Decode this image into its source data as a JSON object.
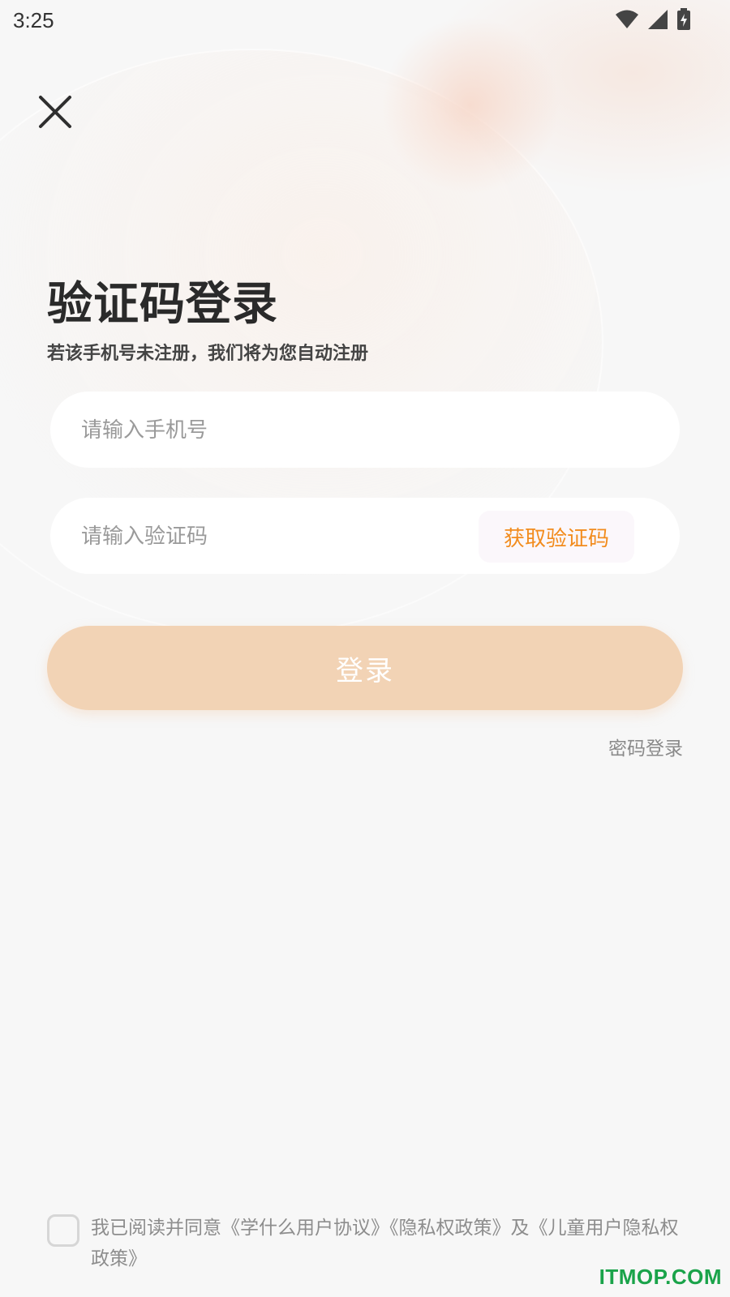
{
  "status_bar": {
    "time": "3:25",
    "icons": [
      "wifi-icon",
      "signal-icon",
      "battery-charging-icon"
    ]
  },
  "header": {
    "close_icon": "close-icon"
  },
  "page": {
    "title": "验证码登录",
    "subtitle": "若该手机号未注册，我们将为您自动注册"
  },
  "form": {
    "phone_placeholder": "请输入手机号",
    "phone_value": "",
    "code_placeholder": "请输入验证码",
    "code_value": "",
    "get_code_label": "获取验证码",
    "login_label": "登录",
    "password_login_label": "密码登录"
  },
  "agreement": {
    "prefix": "我已阅读并同意",
    "user_agreement": "《学什么用户协议》",
    "privacy_policy": "《隐私权政策》",
    "conjunction": "及",
    "child_privacy_policy": "《儿童用户隐私权政策》",
    "checked": false
  },
  "watermark": {
    "text": "ITMOP.COM"
  },
  "colors": {
    "accent": "#f28c1e",
    "login_button": "#f2d3b5",
    "background": "#f7f7f7",
    "watermark": "#1aa34a"
  }
}
